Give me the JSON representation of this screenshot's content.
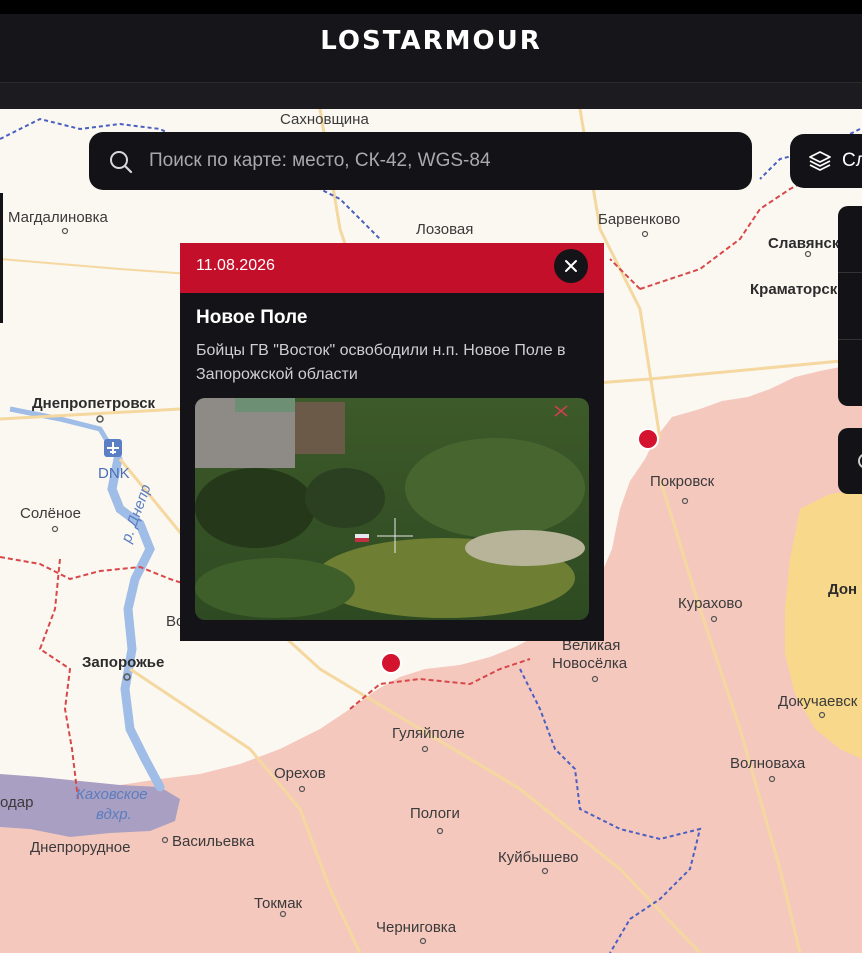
{
  "header": {
    "logo": "LOSTARMOUR"
  },
  "search": {
    "placeholder": "Поиск по карте: место, СК-42, WGS-84",
    "value": ""
  },
  "layers": {
    "label": "Сл"
  },
  "popup": {
    "date": "11.08.2026",
    "title": "Новое Поле",
    "description": "Бойцы ГВ \"Восток\" освободили н.п. Новое Поле в Запорожской области"
  },
  "map": {
    "labels": {
      "sakhnovshchina": "Сахновщина",
      "magdalinovka": "Магдалиновка",
      "lozovaya": "Лозовая",
      "barvenkovo": "Барвенково",
      "slavyansk": "Славянск",
      "kramatorsk": "Краматорск",
      "dnepropetrovsk": "Днепропетровск",
      "dnk": "DNK",
      "solenoe": "Солёное",
      "river_dnepr": "р. Днепр",
      "pokrovsk": "Покровск",
      "kurakhovo": "Курахово",
      "don": "Дон",
      "velikaya_novoselka_1": "Великая",
      "velikaya_novoselka_2": "Новосёлка",
      "zaporozhye": "Запорожье",
      "vo": "Во",
      "dokuchaevsk": "Докучаевск",
      "gulyaipole": "Гуляйполе",
      "orekhov": "Орехов",
      "volnovakha": "Волноваха",
      "kakhovka_1": "Каховское",
      "kakhovka_2": "вдхр.",
      "odar": "одар",
      "dneprorudnoe": "Днепрорудное",
      "vasilevka": "Васильевка",
      "pologi": "Пологи",
      "kuibyshevo": "Куйбышево",
      "tokmak": "Токмак",
      "chernigovka": "Черниговка"
    }
  },
  "colors": {
    "occupied": "#f5c8be",
    "contested": "#f8d88a",
    "marker": "#d4142f",
    "popup_header": "#c40f2a",
    "border_red": "#d8484a",
    "border_blue": "#4a5fc0"
  }
}
